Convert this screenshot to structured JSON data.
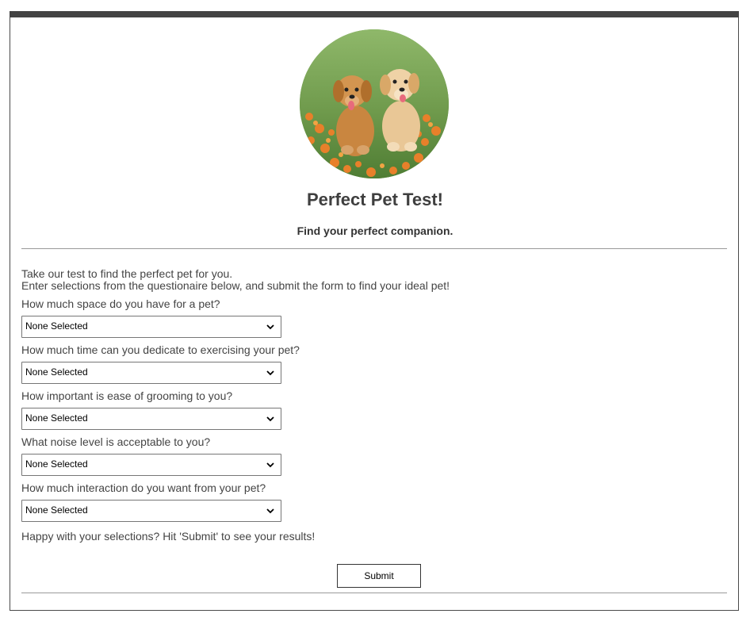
{
  "header": {
    "title": "Perfect Pet Test!",
    "subtitle": "Find your perfect companion.",
    "image_alt": "two golden retriever puppies"
  },
  "intro": {
    "line1": "Take our test to find the perfect pet for you.",
    "line2": "Enter selections from the questionaire below, and submit the form to find your ideal pet!"
  },
  "questions": [
    {
      "label": "How much space do you have for a pet?",
      "selected": "None Selected"
    },
    {
      "label": "How much time can you dedicate to exercising your pet?",
      "selected": "None Selected"
    },
    {
      "label": "How important is ease of grooming to you?",
      "selected": "None Selected"
    },
    {
      "label": "What noise level is acceptable to you?",
      "selected": "None Selected"
    },
    {
      "label": "How much interaction do you want from your pet?",
      "selected": "None Selected"
    }
  ],
  "closing_text": "Happy with your selections? Hit 'Submit' to see your results!",
  "submit_label": "Submit",
  "colors": {
    "top_bar": "#434343",
    "text": "#444444",
    "divider": "#9a9a9a"
  }
}
